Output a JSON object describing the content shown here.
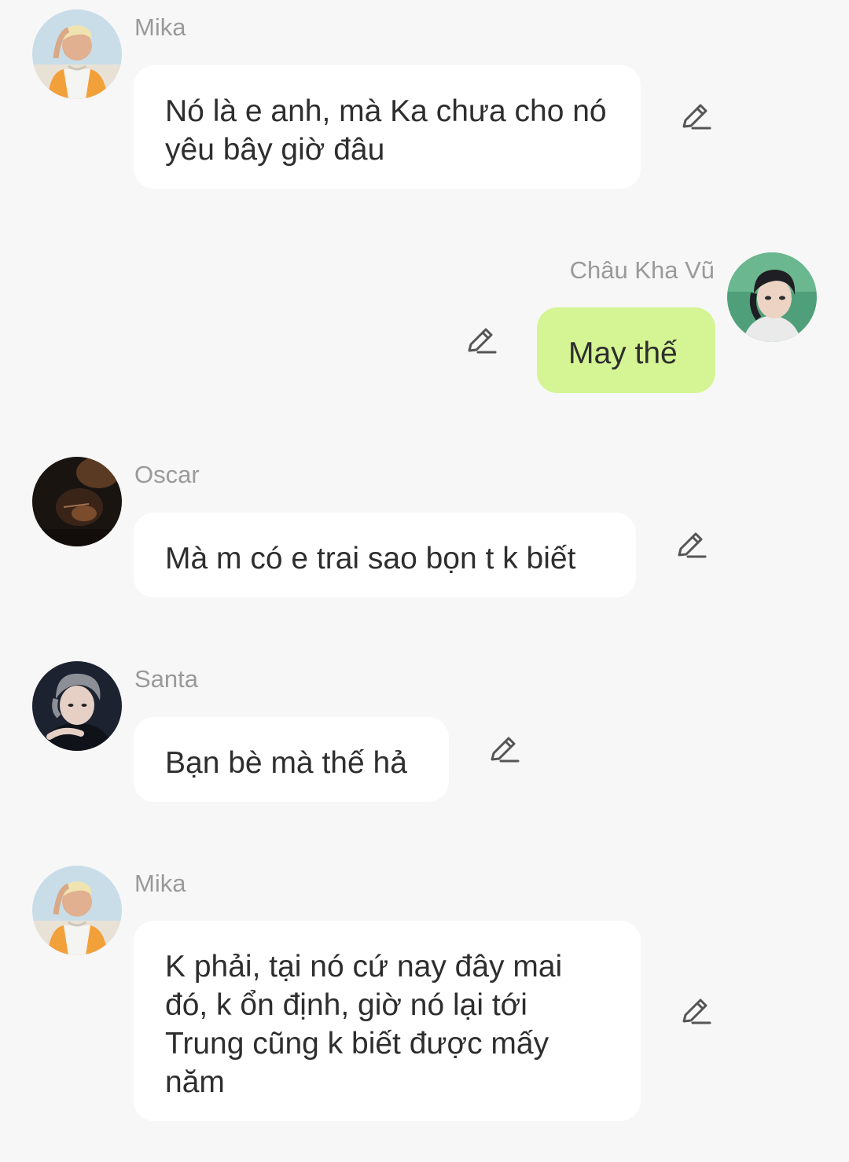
{
  "messages": [
    {
      "sender": "Mika",
      "text": "Nó là e anh, mà Ka chưa cho nó yêu bây giờ đâu",
      "own": false,
      "avatar_icon": "avatar-mika"
    },
    {
      "sender": "Châu Kha Vũ",
      "text": "May thế",
      "own": true,
      "avatar_icon": "avatar-chau-kha-vu"
    },
    {
      "sender": "Oscar",
      "text": "Mà m có e trai sao bọn t k biết",
      "own": false,
      "avatar_icon": "avatar-oscar"
    },
    {
      "sender": "Santa",
      "text": "Bạn bè mà thế hả",
      "own": false,
      "avatar_icon": "avatar-santa"
    },
    {
      "sender": "Mika",
      "text": "K phải, tại nó cứ nay đây mai đó, k ổn định, giờ nó lại tới Trung cũng k biết được mấy năm",
      "own": false,
      "avatar_icon": "avatar-mika"
    }
  ],
  "colors": {
    "background": "#f7f7f7",
    "bubble_other": "#ffffff",
    "bubble_own": "#d5f594",
    "sender_name": "#9a9a9a",
    "edit_icon": "#555555"
  }
}
